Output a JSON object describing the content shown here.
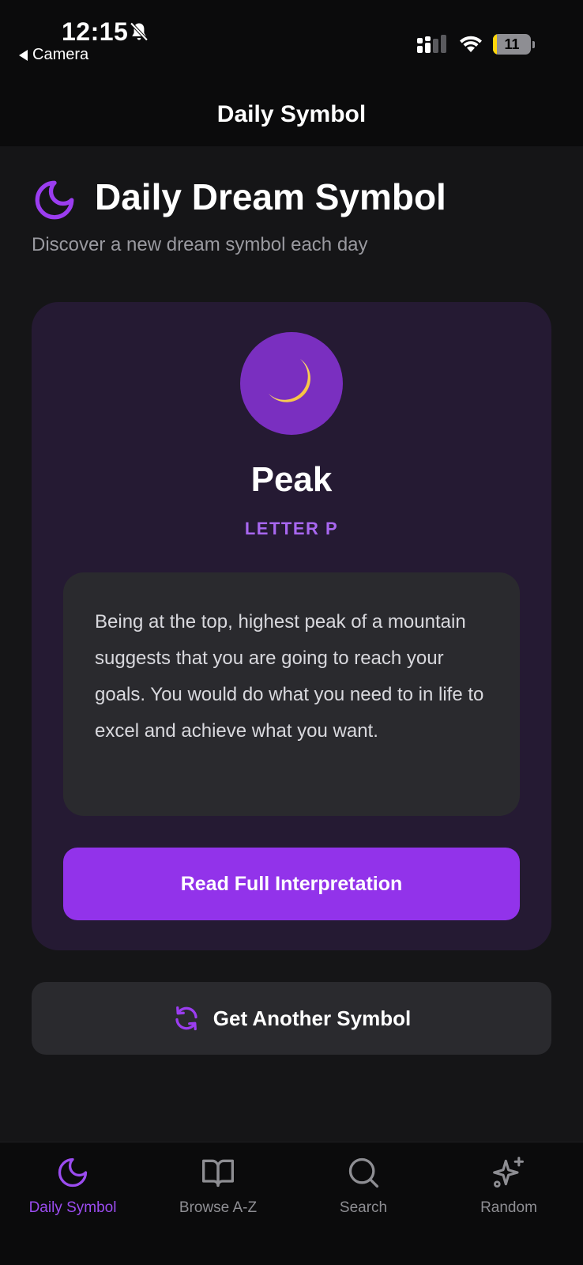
{
  "status_bar": {
    "time": "12:15",
    "back_label": "Camera",
    "battery_level": "11",
    "battery_fraction": 0.11
  },
  "nav": {
    "title": "Daily Symbol"
  },
  "header": {
    "title": "Daily Dream Symbol",
    "subtitle": "Discover a new dream symbol each day",
    "icon": "moon-icon"
  },
  "symbol": {
    "emoji_icon": "crescent-moon-icon",
    "name": "Peak",
    "letter": "LETTER P",
    "description": "Being at the top, highest peak of a mountain suggests that you are going to reach your goals. You would do what you need to in life to excel and achieve what you want.",
    "read_button": "Read Full Interpretation"
  },
  "another_button": {
    "label": "Get Another Symbol",
    "icon": "refresh-icon"
  },
  "tabs": [
    {
      "label": "Daily Symbol",
      "icon": "moon-icon",
      "active": true
    },
    {
      "label": "Browse A-Z",
      "icon": "book-icon",
      "active": false
    },
    {
      "label": "Search",
      "icon": "search-icon",
      "active": false
    },
    {
      "label": "Random",
      "icon": "sparkles-icon",
      "active": false
    }
  ],
  "colors": {
    "accent": "#9233ea",
    "accent_text": "#a867f0",
    "card_bg": "#251a33",
    "background": "#151517"
  }
}
